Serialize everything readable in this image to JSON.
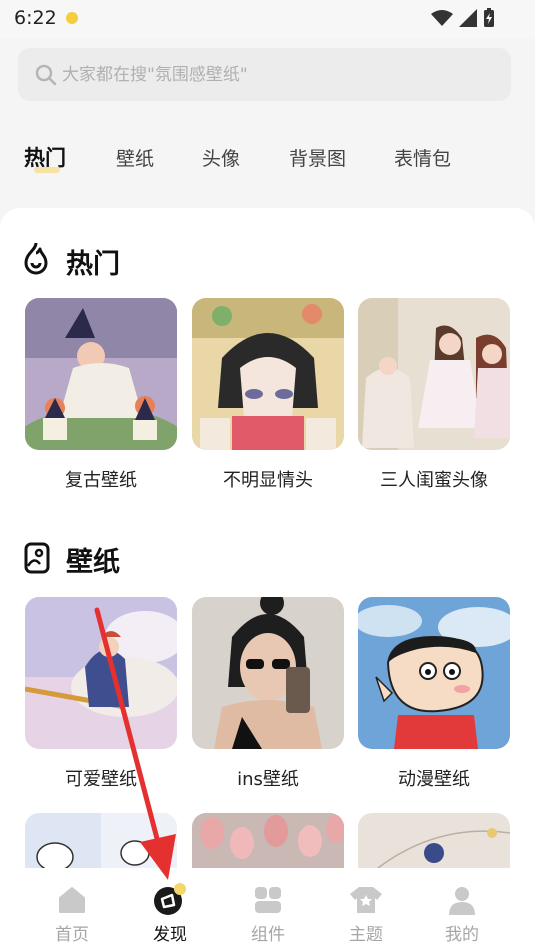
{
  "status": {
    "time": "6:22"
  },
  "search": {
    "placeholder": "大家都在搜\"氛围感壁纸\""
  },
  "tabs": [
    "热门",
    "壁纸",
    "头像",
    "背景图",
    "表情包"
  ],
  "sections": {
    "hot": {
      "title": "热门",
      "items": [
        "复古壁纸",
        "不明显情头",
        "三人闺蜜头像"
      ]
    },
    "wallpaper": {
      "title": "壁纸",
      "items": [
        "可爱壁纸",
        "ins壁纸",
        "动漫壁纸"
      ]
    }
  },
  "bottom_nav": [
    {
      "label": "首页",
      "icon": "home-icon"
    },
    {
      "label": "发现",
      "icon": "discover-icon",
      "active": true
    },
    {
      "label": "组件",
      "icon": "widgets-icon"
    },
    {
      "label": "主题",
      "icon": "theme-shirt-icon"
    },
    {
      "label": "我的",
      "icon": "profile-icon"
    }
  ],
  "colors": {
    "accent": "#f8e2a3",
    "annotation_arrow": "#e53030"
  }
}
